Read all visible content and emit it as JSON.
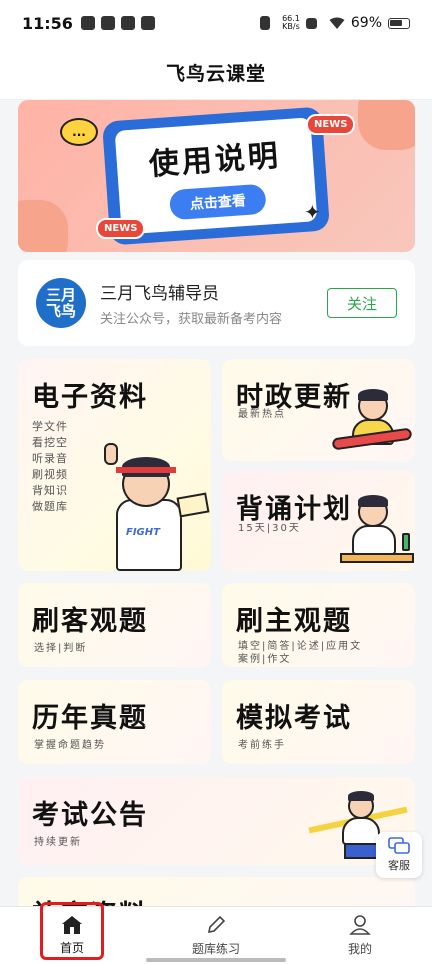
{
  "status_bar": {
    "time": "11:56",
    "net_speed_value": "66.1",
    "net_speed_unit": "KB/s",
    "battery": "69%"
  },
  "header": {
    "title": "飞鸟云课堂"
  },
  "banner": {
    "title": "使用说明",
    "button": "点击查看",
    "news_tag": "NEWS",
    "chat_glyph": "..."
  },
  "official_account": {
    "logo_line1": "三月",
    "logo_line2": "飞鸟",
    "name": "三月飞鸟辅导员",
    "desc": "关注公众号，获取最新备考内容",
    "follow_label": "关注"
  },
  "cards": {
    "ebooks": {
      "title": "电子资料",
      "items": [
        "学文件",
        "看挖空",
        "听录音",
        "刷视频",
        "背知识",
        "做题库"
      ],
      "badge": "FIGHT"
    },
    "politics": {
      "title": "时政更新",
      "sub": "最新热点"
    },
    "recite": {
      "title": "背诵计划",
      "sub": "15天|30天"
    },
    "objective": {
      "title": "刷客观题",
      "sub": "选择|判断"
    },
    "subjective": {
      "title": "刷主观题",
      "sub_line1": "填空|简答|论述|应用文",
      "sub_line2": "案例|作文"
    },
    "past_exams": {
      "title": "历年真题",
      "sub": "掌握命题趋势"
    },
    "mock_exam": {
      "title": "模拟考试",
      "sub": "考前练手"
    },
    "announcements": {
      "title": "考试公告",
      "sub": "持续更新"
    },
    "supplement": {
      "title": "补充资料"
    }
  },
  "customer_service": {
    "label": "客服"
  },
  "tabbar": {
    "items": [
      {
        "label": "首页",
        "icon": "home-icon",
        "active": true
      },
      {
        "label": "题库练习",
        "icon": "pencil-icon",
        "active": false
      },
      {
        "label": "我的",
        "icon": "person-icon",
        "active": false
      }
    ]
  },
  "colors": {
    "accent_blue": "#3c7ef2",
    "follow_green": "#2aa54a",
    "highlight_red": "#e01e1e"
  }
}
